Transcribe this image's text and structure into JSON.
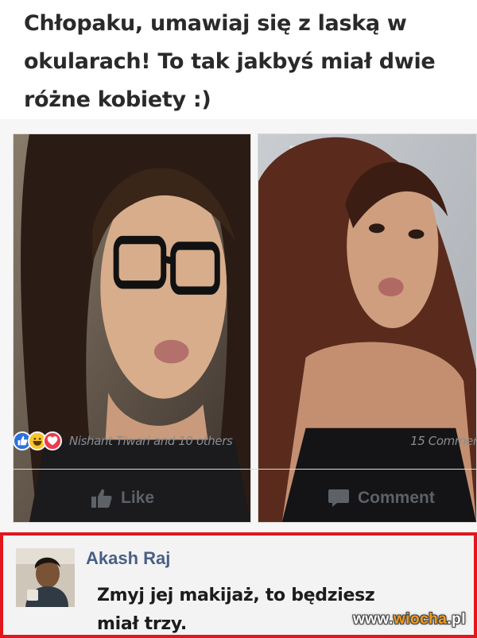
{
  "headline": {
    "line1": "Chłopaku, umawiaj się z laską w",
    "line2": "okularach! To tak jakbyś miał dwie",
    "line3": "różne kobiety :)"
  },
  "post": {
    "photos": [
      {
        "description_icon": "photo-icon"
      },
      {
        "description_icon": "photo-icon"
      }
    ],
    "reactions": {
      "icons": [
        "like-icon",
        "haha-icon",
        "love-icon"
      ],
      "names": "Nishant Tiwari and 10 others",
      "comments_count": "15 Commen"
    },
    "actions": {
      "like_label": "Like",
      "comment_label": "Comment"
    }
  },
  "comment": {
    "author": "Akash Raj",
    "text_line1": "Zmyj jej makijaż, to będziesz",
    "text_line2": "miał trzy."
  },
  "watermark": {
    "prefix": "www.",
    "highlight": "wiocha",
    "suffix": ".pl"
  },
  "colors": {
    "accent_red": "#e3161b",
    "author_blue": "#485f86",
    "like_blue": "#2d6fdc",
    "action_gray": "#5d6168"
  }
}
